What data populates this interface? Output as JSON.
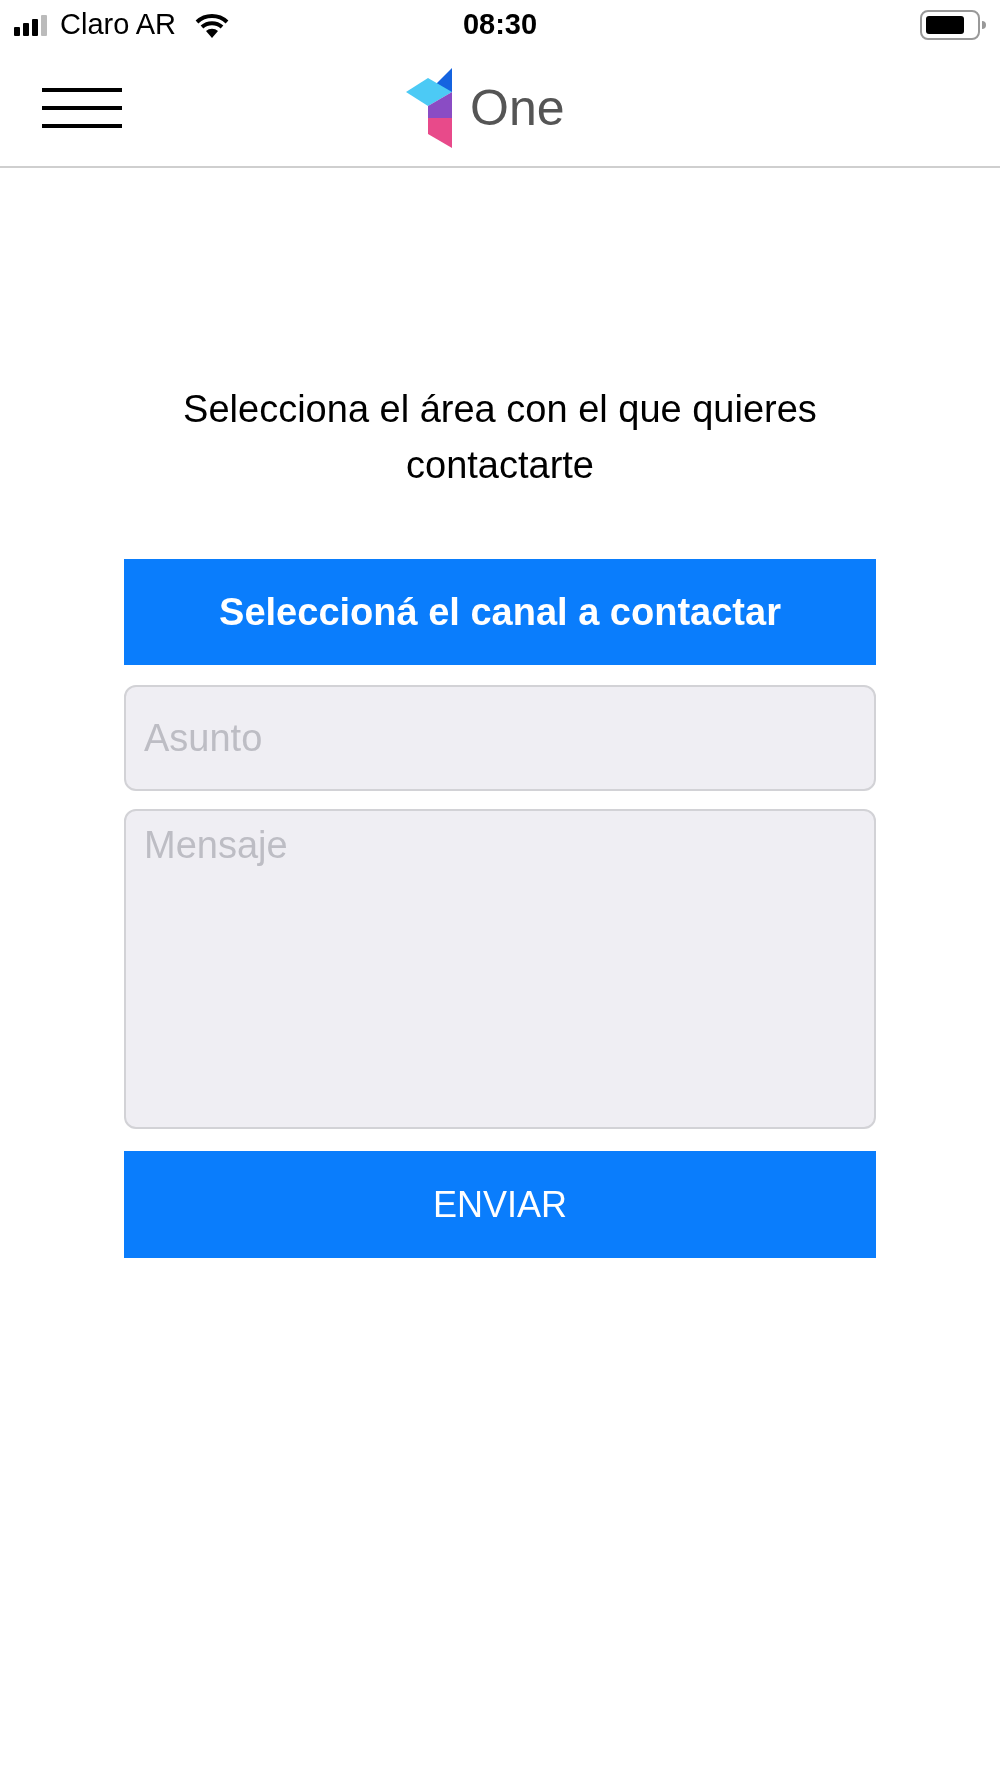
{
  "status_bar": {
    "carrier": "Claro AR",
    "time": "08:30"
  },
  "header": {
    "app_name": "One"
  },
  "prompt": "Selecciona el área con el que quieres contactarte",
  "channel_button": {
    "label": "Seleccioná el canal a contactar"
  },
  "subject_field": {
    "placeholder": "Asunto"
  },
  "message_field": {
    "placeholder": "Mensaje"
  },
  "send_button": {
    "label": "ENVIAR"
  }
}
